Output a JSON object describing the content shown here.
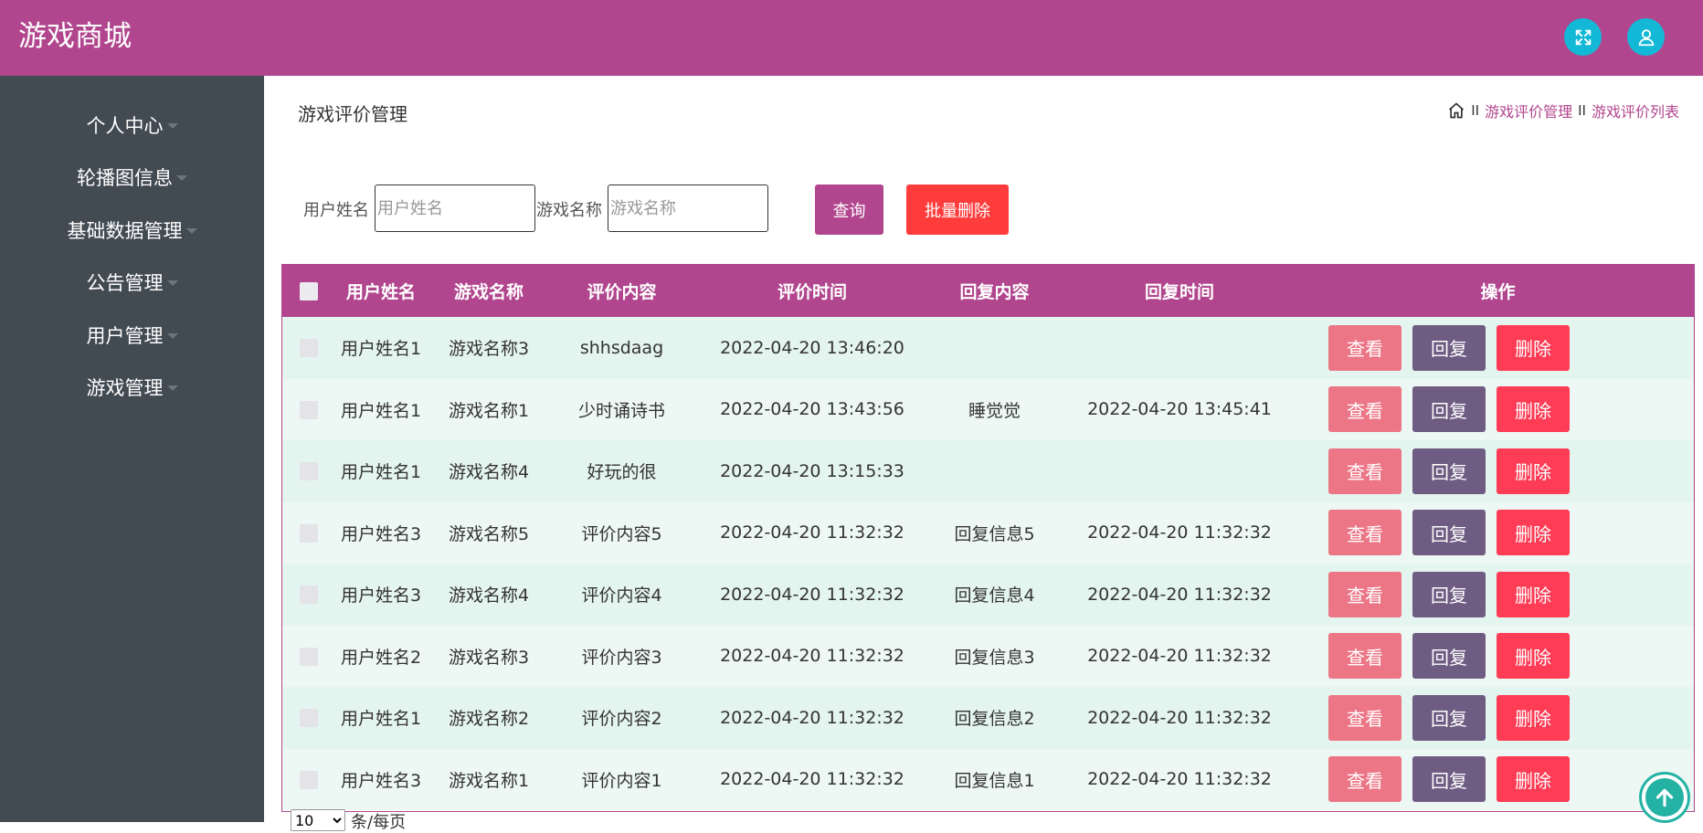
{
  "app": {
    "title": "游戏商城"
  },
  "header": {
    "fullscreen_icon": "expand-icon",
    "user_icon": "user-icon"
  },
  "sidebar": {
    "items": [
      {
        "label": "个人中心"
      },
      {
        "label": "轮播图信息"
      },
      {
        "label": "基础数据管理"
      },
      {
        "label": "公告管理"
      },
      {
        "label": "用户管理"
      },
      {
        "label": "游戏管理"
      }
    ]
  },
  "page": {
    "title": "游戏评价管理",
    "breadcrumb": [
      "游戏评价管理",
      "游戏评价列表"
    ],
    "breadcrumb_sep": "II"
  },
  "search": {
    "user_label": "用户姓名",
    "user_placeholder": "用户姓名",
    "game_label": "游戏名称",
    "game_placeholder": "游戏名称",
    "query_button": "查询",
    "batch_delete_button": "批量删除"
  },
  "table": {
    "columns": [
      "用户姓名",
      "游戏名称",
      "评价内容",
      "评价时间",
      "回复内容",
      "回复时间",
      "操作"
    ],
    "actions": {
      "view": "查看",
      "reply": "回复",
      "delete": "删除"
    },
    "rows": [
      {
        "user": "用户姓名1",
        "game": "游戏名称3",
        "content": "shhsdaag",
        "time": "2022-04-20 13:46:20",
        "reply": "",
        "reply_time": ""
      },
      {
        "user": "用户姓名1",
        "game": "游戏名称1",
        "content": "少时诵诗书",
        "time": "2022-04-20 13:43:56",
        "reply": "睡觉觉",
        "reply_time": "2022-04-20 13:45:41"
      },
      {
        "user": "用户姓名1",
        "game": "游戏名称4",
        "content": "好玩的很",
        "time": "2022-04-20 13:15:33",
        "reply": "",
        "reply_time": ""
      },
      {
        "user": "用户姓名3",
        "game": "游戏名称5",
        "content": "评价内容5",
        "time": "2022-04-20 11:32:32",
        "reply": "回复信息5",
        "reply_time": "2022-04-20 11:32:32"
      },
      {
        "user": "用户姓名3",
        "game": "游戏名称4",
        "content": "评价内容4",
        "time": "2022-04-20 11:32:32",
        "reply": "回复信息4",
        "reply_time": "2022-04-20 11:32:32"
      },
      {
        "user": "用户姓名2",
        "game": "游戏名称3",
        "content": "评价内容3",
        "time": "2022-04-20 11:32:32",
        "reply": "回复信息3",
        "reply_time": "2022-04-20 11:32:32"
      },
      {
        "user": "用户姓名1",
        "game": "游戏名称2",
        "content": "评价内容2",
        "time": "2022-04-20 11:32:32",
        "reply": "回复信息2",
        "reply_time": "2022-04-20 11:32:32"
      },
      {
        "user": "用户姓名3",
        "game": "游戏名称1",
        "content": "评价内容1",
        "time": "2022-04-20 11:32:32",
        "reply": "回复信息1",
        "reply_time": "2022-04-20 11:32:32"
      }
    ]
  },
  "pagination": {
    "page_size": "10",
    "page_size_suffix": "条/每页"
  },
  "colors": {
    "brand": "#b1468e",
    "sidebar": "#424a52",
    "view_button": "#ec7686",
    "reply_button": "#6e5c82",
    "delete_button": "#fe3c55",
    "scroll_top": "#24b2a4"
  }
}
